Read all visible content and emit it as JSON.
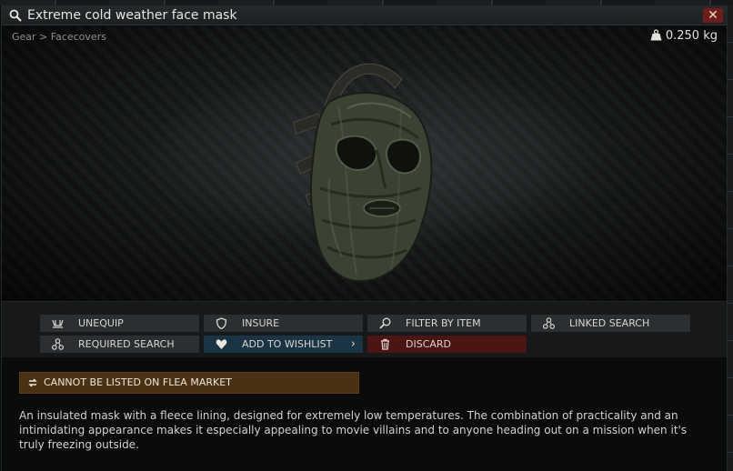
{
  "window": {
    "title": "Extreme cold weather face mask",
    "close_label": "✕"
  },
  "preview": {
    "breadcrumb": "Gear > Facecovers",
    "weight": "0.250 kg"
  },
  "actions": [
    {
      "label": "UNEQUIP",
      "icon": "unequip-icon"
    },
    {
      "label": "INSURE",
      "icon": "shield-icon"
    },
    {
      "label": "FILTER BY ITEM",
      "icon": "magnifier-icon"
    },
    {
      "label": "LINKED SEARCH",
      "icon": "linked-search-icon"
    },
    {
      "label": "REQUIRED SEARCH",
      "icon": "required-search-icon"
    },
    {
      "label": "ADD TO WISHLIST",
      "icon": "heart-icon"
    },
    {
      "label": "DISCARD",
      "icon": "trash-icon"
    }
  ],
  "flea_notice": {
    "label": "CANNOT BE LISTED ON FLEA MARKET",
    "icon": "swap-icon"
  },
  "description": "An insulated mask with a fleece lining, designed for extremely low temperatures. The combination of practicality and an intimidating appearance makes it especially appealing to movie villains and to anyone heading out on a mission when it's truly freezing outside.",
  "colors": {
    "wishlist_bg": "#1b3443",
    "discard_bg": "#4a1512",
    "flea_bg": "#4a3114",
    "close_bg": "#6d1e1a"
  }
}
